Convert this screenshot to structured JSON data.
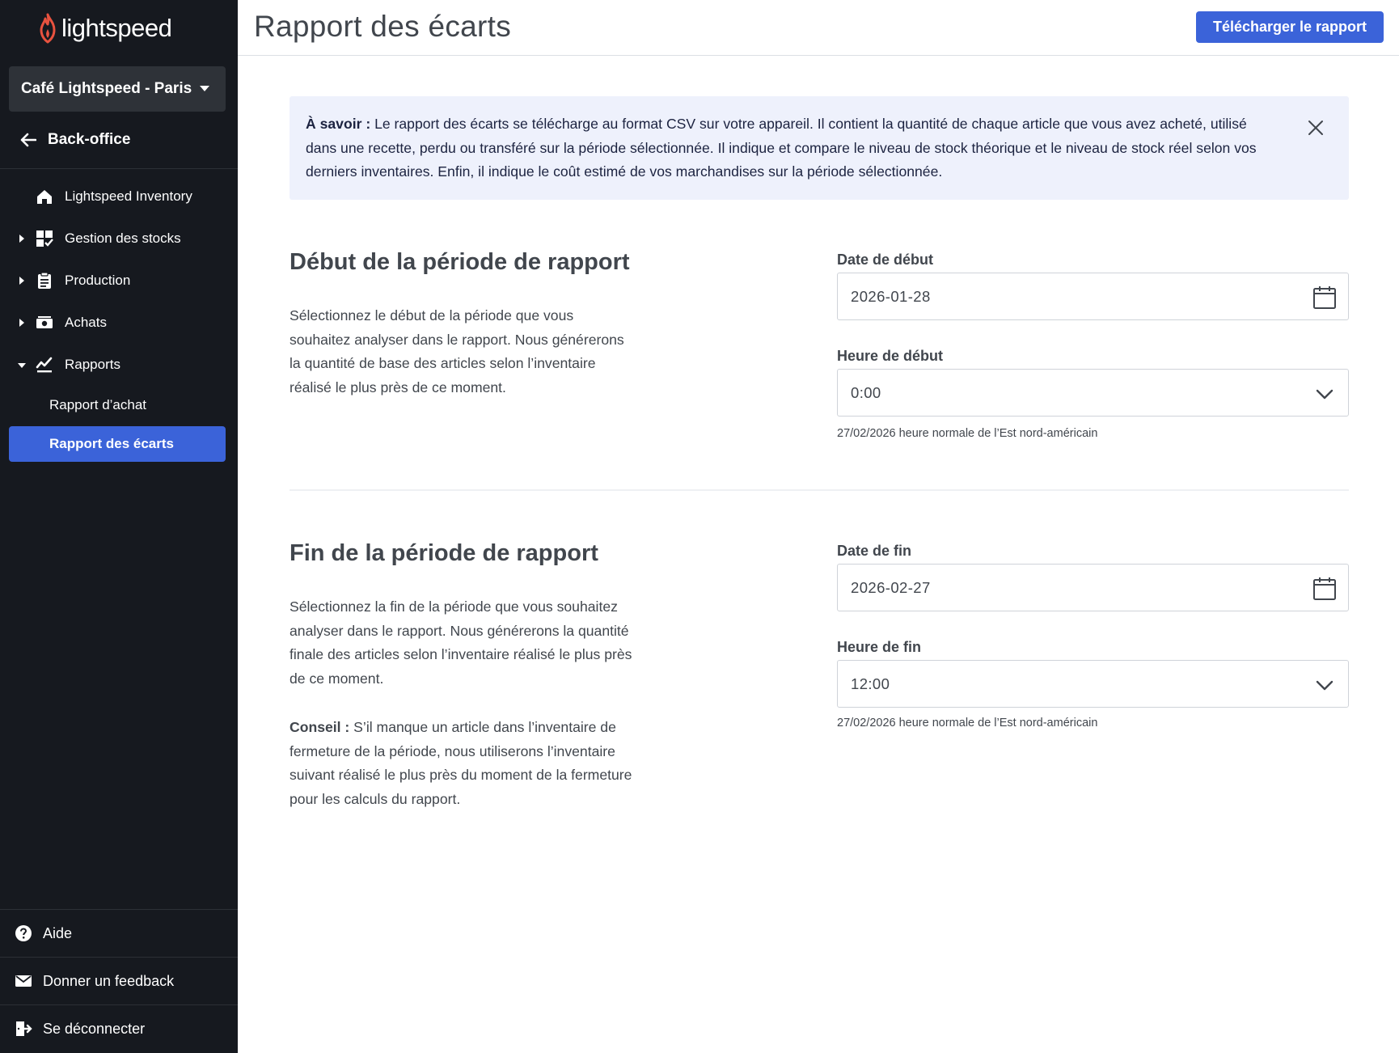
{
  "app": {
    "logo_text": "lightspeed"
  },
  "sidebar": {
    "store": "Café Lightspeed - Paris",
    "back": "Back-office",
    "items": [
      {
        "label": "Lightspeed Inventory",
        "icon": "home-icon"
      },
      {
        "label": "Gestion des stocks",
        "icon": "stock-grid-icon"
      },
      {
        "label": "Production",
        "icon": "clipboard-icon"
      },
      {
        "label": "Achats",
        "icon": "money-icon"
      },
      {
        "label": "Rapports",
        "icon": "chart-check-icon"
      }
    ],
    "sub_items": [
      {
        "label": "Rapport d’achat"
      },
      {
        "label": "Rapport des écarts"
      }
    ],
    "footer": [
      {
        "label": "Aide",
        "icon": "help-icon"
      },
      {
        "label": "Donner un feedback",
        "icon": "mail-icon"
      },
      {
        "label": "Se déconnecter",
        "icon": "logout-icon"
      }
    ]
  },
  "header": {
    "title": "Rapport des écarts",
    "download_label": "Télécharger le rapport"
  },
  "info": {
    "prefix": "À savoir :",
    "text": " Le rapport des écarts se télécharge au format CSV sur votre appareil. Il contient la quantité de chaque article que vous avez acheté, utilisé dans une recette, perdu ou transféré sur la période sélectionnée. Il indique et compare le niveau de stock théorique et le niveau de stock réel selon vos derniers inventaires. Enfin, il indique le coût estimé de vos marchandises sur la période sélectionnée."
  },
  "start": {
    "title": "Début de la période de rapport",
    "description": "Sélectionnez le début de la période que vous souhaitez analyser dans le rapport. Nous générerons la quantité de base des articles selon l’inventaire réalisé le plus près de ce moment.",
    "date_label": "Date de début",
    "date_value": "2026-01-28",
    "time_label": "Heure de début",
    "time_value": "0:00",
    "helper": "27/02/2026 heure normale de l’Est nord-américain"
  },
  "end": {
    "title": "Fin de la période de rapport",
    "description": "Sélectionnez la fin de la période que vous souhaitez analyser dans le rapport. Nous générerons la quantité finale des articles selon l’inventaire réalisé le plus près de ce moment.",
    "tip_prefix": "Conseil :",
    "tip_text": " S’il manque un article dans l’inventaire de fermeture de la période, nous utiliserons l’inventaire suivant réalisé le plus près du moment de la fermeture pour les calculs du rapport.",
    "date_label": "Date de fin",
    "date_value": "2026-02-27",
    "time_label": "Heure de fin",
    "time_value": "12:00",
    "helper": "27/02/2026 heure normale de l’Est nord-américain"
  },
  "colors": {
    "sidebar_bg": "#16191f",
    "accent": "#3b63d9",
    "logo_red": "#e8523f",
    "info_bg": "#eef1fc"
  }
}
